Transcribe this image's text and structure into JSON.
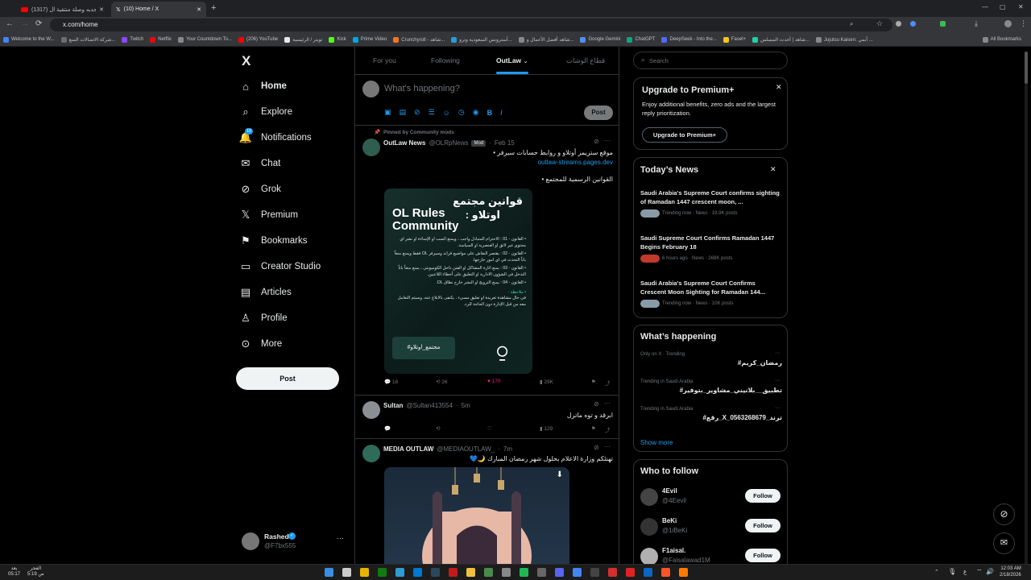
{
  "browser": {
    "tabs": [
      {
        "label": "(1317) سالم الجدبه وصلة منتقية ال..."
      },
      {
        "label": "(10) Home / X"
      }
    ],
    "url": "x.com/home",
    "bookmarks": [
      "Welcome to the W...",
      "شركة الاتصالات السع...",
      "Twitch",
      "Netflix",
      "Your Countdown To...",
      "(206) YouTube",
      "تويتر / الرئيسية",
      "Kick",
      "Prime Video",
      "Crunchyroll - شاهد...",
      "أسترونس السعودية وترو...",
      "شاهد أفضل الأعمال و...",
      "Google Gemini",
      "ChatGPT",
      "DeepSeek - Into the...",
      "Fasel+",
      "شاهد | أحدث المسلس...",
      "Jujutsu Kaisen: أنمي ...",
      "All Bookmarks"
    ],
    "bookmark_colors": [
      "#4285f4",
      "#6d6d6d",
      "#9146ff",
      "#e50914",
      "#888888",
      "#ff0000",
      "#e7e9ea",
      "#53fc18",
      "#00a8e1",
      "#f47521",
      "#2b9bd6",
      "#888888",
      "#4f8df7",
      "#10a37f",
      "#4d6bfe",
      "#f5c518",
      "#1dd1a1",
      "#888888",
      "#888888"
    ]
  },
  "sidebar": {
    "logo": "X",
    "items": [
      {
        "label": "Home",
        "icon": "home-icon",
        "glyph": "⌂"
      },
      {
        "label": "Explore",
        "icon": "search-icon",
        "glyph": "⌕"
      },
      {
        "label": "Notifications",
        "icon": "bell-icon",
        "glyph": "🔔",
        "badge": "10"
      },
      {
        "label": "Chat",
        "icon": "mail-icon",
        "glyph": "✉"
      },
      {
        "label": "Grok",
        "icon": "grok-icon",
        "glyph": "⊘"
      },
      {
        "label": "Premium",
        "icon": "x-logo-icon",
        "glyph": "𝕏"
      },
      {
        "label": "Bookmarks",
        "icon": "bookmark-icon",
        "glyph": "⚑"
      },
      {
        "label": "Creator Studio",
        "icon": "creator-studio-icon",
        "glyph": "▭"
      },
      {
        "label": "Articles",
        "icon": "articles-icon",
        "glyph": "▤"
      },
      {
        "label": "Profile",
        "icon": "profile-icon",
        "glyph": "♙"
      },
      {
        "label": "More",
        "icon": "more-circle-icon",
        "glyph": "⊙"
      }
    ],
    "post_button": "Post",
    "account": {
      "name": "Rashed",
      "handle": "@F7bx555",
      "more": "···"
    }
  },
  "timeline": {
    "tabs": [
      "For you",
      "Following",
      "OutLaw",
      "قطاع الوشات"
    ],
    "active_tab": "OutLaw",
    "composer": {
      "placeholder": "What's happening?",
      "post_button": "Post"
    },
    "tweets": [
      {
        "pinned_label": "Pinned by Community mods",
        "name": "OutLaw News",
        "handle": "@OLRpNews",
        "badge": "Mod",
        "time": "Feb 15",
        "line1": "موقع ستريمز أوتلاو و روابط حسابات سيرفر •",
        "link": "outlaw-streams.pages.dev",
        "line2": "القوانين الرسمية للمجتمع •",
        "image": {
          "title_ar": "قوانين مجتمع",
          "title_ar2": "اوتلاو :",
          "title_en1": "OL Rules",
          "title_en2": "Community",
          "rules": [
            "• القانون - 01 : الاحترام المتبادل واجب ، ويمنع السب او الإساءة او نشر اي محتوى غير لائق او العنصرية او السياسة.",
            "• القانون - 02 : يقتصر النقاش على مواضيع قراند وسيرفر OL فقط ويمنع منعاً باتاً التحدث في اي امور خارجها.",
            "• القانون - 03 : يمنع اثارة المشاكل او الفتن داخل الكوميونتي ، يمنع منعاً باتاً التدخل في الشؤون الادارية او التعليق على أخطاء اللاعبين.",
            "• القانون - 04 : يمنع الترويج او النشر خارج نطاق OL."
          ],
          "note_title": "• ملاحظة :",
          "note": "في حال مشاهدة تغريدة او تعليق مسيء ، يكتفى بالابلاغ عنه، وسيتم التعامل معه من قبل الإدارة دون الحاجة للرد.",
          "footer": "مجتمع_اوتلاو#"
        },
        "stats": {
          "replies": "18",
          "reposts": "26",
          "likes": "170",
          "views": "29K"
        }
      },
      {
        "name": "Sultan",
        "handle": "@Sultan413554",
        "time": "5m",
        "text": "ابرقد و توه ماترل",
        "stats": {
          "replies": "",
          "reposts": "",
          "likes": "",
          "views": "129"
        }
      },
      {
        "name": "MEDIA OUTLAW",
        "handle": "@MEDIAOUTLAW_",
        "time": "7m",
        "text": "تهنئكم وزارة الاعلام بحلول شهر رمضان المبارك 🌙💙"
      }
    ]
  },
  "right": {
    "search_placeholder": "Search",
    "premium": {
      "title": "Upgrade to Premium+",
      "text": "Enjoy additional benefits, zero ads and the largest reply prioritization.",
      "button": "Upgrade to Premium+"
    },
    "news": {
      "title": "Today’s News",
      "items": [
        {
          "title": "Saudi Arabia's Supreme Court confirms sighting of Ramadan 1447 crescent moon, ...",
          "meta": "Trending now · News · 19.9K posts"
        },
        {
          "title": "Saudi Supreme Court Confirms Ramadan 1447 Begins February 18",
          "meta": "6 hours ago · News · 268K posts"
        },
        {
          "title": "Saudi Arabia's Supreme Court Confirms Crescent Moon Sighting for Ramadan 144...",
          "meta": "Trending now · News · 10K posts"
        }
      ]
    },
    "happening": {
      "title": "What’s happening",
      "items": [
        {
          "context": "Only on X · Trending",
          "name": "#رمضان_كريم"
        },
        {
          "context": "Trending in Saudi Arabia",
          "name": "#تطبيق__بلانيني_مشاوير_بتوفير"
        },
        {
          "context": "Trending in Saudi Arabia",
          "name": "#رقع_X_ترند_0563268679"
        }
      ],
      "show_more": "Show more"
    },
    "who_to_follow": {
      "title": "Who to follow",
      "items": [
        {
          "name": "4Evil",
          "handle": "@4Eevil",
          "button": "Follow"
        },
        {
          "name": "BeKi",
          "handle": "@1iBeKi",
          "button": "Follow"
        },
        {
          "name": "F1aisal.",
          "handle": "@Faisalawad1M",
          "button": "Follow"
        }
      ]
    }
  },
  "taskbar": {
    "weather_line1": "يعد",
    "weather_line2": "05:17",
    "prayer_line1": "الفجر",
    "prayer_line2": "5:19 ص",
    "lang": "ع",
    "time": "12:03 AM",
    "date": "2/18/2026"
  }
}
